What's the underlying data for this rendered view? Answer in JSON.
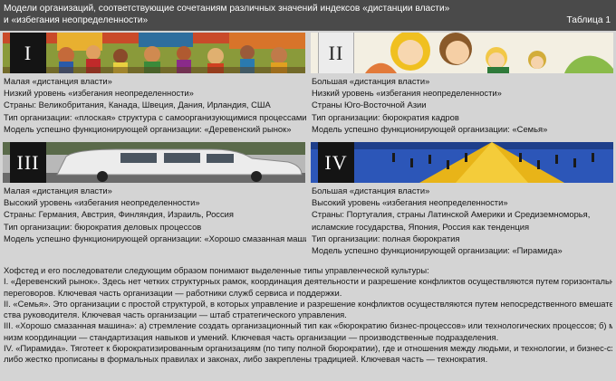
{
  "header": {
    "title_line1": "Модели организаций, соответствующие сочетаниям различных значений индексов «дистанции власти»",
    "title_line2": "и «избегания неопределенности»",
    "table_label": "Таблица 1"
  },
  "quadrants": [
    {
      "roman": "I",
      "lines": [
        "Малая «дистанция власти»",
        "Низкий уровень «избегания неопределенности»",
        "Страны: Великобритания, Канада, Швеция, Дания, Ирландия, США",
        "Тип организации: «плоская» структура с самоорганизующимися процессами",
        "Модель успешно функционирующей организации: «Деревенский рынок»"
      ]
    },
    {
      "roman": "II",
      "lines": [
        "Большая «дистанция власти»",
        "Низкий уровень «избегания неопределенности»",
        "Страны Юго-Восточной Азии",
        "Тип организации: бюрократия кадров",
        "Модель успешно функционирующей организации: «Семья»"
      ]
    },
    {
      "roman": "III",
      "lines": [
        "Малая «дистанция власти»",
        "Высокий уровень «избегания неопределенности»",
        "Страны: Германия, Австрия, Финляндия, Израиль, Россия",
        "Тип организации: бюрократия деловых процессов",
        "Модель успешно функционирующей организации: «Хорошо смазанная машина»"
      ]
    },
    {
      "roman": "IV",
      "lines": [
        "Большая «дистанция власти»",
        "Высокий уровень «избегания неопределенности»",
        "Страны: Португалия, страны Латинской Америки и Средиземноморья,",
        "исламские государства, Япония, Россия как тенденция",
        "Тип организации: полная бюрократия",
        "Модель успешно функционирующей организации: «Пирамида»"
      ]
    }
  ],
  "summary": {
    "lines": [
      "Хофстед и его последователи следующим образом понимают выделенные типы управленческой культуры:",
      "I. «Деревенский рынок». Здесь нет четких структурных рамок, координация деятельности и разрешение конфликтов осуществляются путем горизонтальных",
      "переговоров. Ключевая часть организации — работники служб сервиса и поддержки.",
      "II. «Семья». Это организации с простой структурой, в которых управление и разрешение конфликтов осуществляются путем непосредственного вмешатель-",
      "ства руководителя. Ключевая часть организации — штаб стратегического управления.",
      "III. «Хорошо смазанная машина»: а) стремление создать организационный тип как «бюрократию бизнес-процессов» или технологических процессов; б) меха-",
      "низм координации — стандартизация навыков и умений. Ключевая часть организации — производственные подразделения.",
      "IV. «Пирамида». Тяготеет к бюрократизированным организациям (по типу полной бюрократии), где и отношения между людьми, и технологии, и бизнес-схемы",
      "либо жестко прописаны в формальных правилах и законах, либо закреплены традицией. Ключевая часть — технократия."
    ]
  }
}
